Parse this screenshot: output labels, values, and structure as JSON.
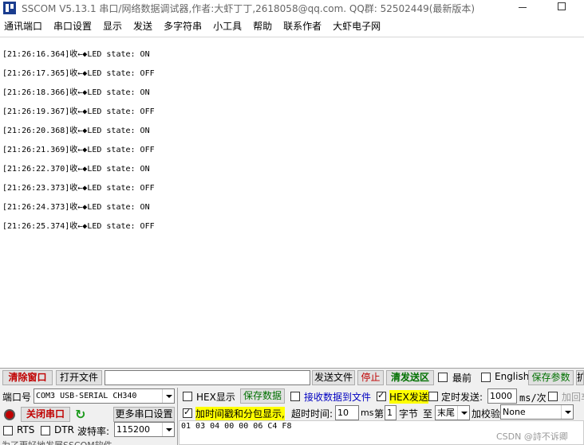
{
  "window": {
    "title": "SSCOM V5.13.1 串口/网络数据调试器,作者:大虾丁丁,2618058@qq.com. QQ群: 52502449(最新版本)"
  },
  "menu": [
    "通讯端口",
    "串口设置",
    "显示",
    "发送",
    "多字符串",
    "小工具",
    "帮助",
    "联系作者",
    "大虾电子网"
  ],
  "receive": {
    "lines": [
      "[21:26:16.364]收←◆LED state: ON",
      "[21:26:17.365]收←◆LED state: OFF",
      "[21:26:18.366]收←◆LED state: ON",
      "[21:26:19.367]收←◆LED state: OFF",
      "[21:26:20.368]收←◆LED state: ON",
      "[21:26:21.369]收←◆LED state: OFF",
      "[21:26:22.370]收←◆LED state: ON",
      "[21:26:23.373]收←◆LED state: OFF",
      "[21:26:24.373]收←◆LED state: ON",
      "[21:26:25.374]收←◆LED state: OFF"
    ]
  },
  "toolbar": {
    "clear_window": "清除窗口",
    "open_file": "打开文件",
    "file_path": "",
    "send_file": "发送文件",
    "stop": "停止",
    "clear_send": "清发送区",
    "front_label": "最前",
    "english_label": "English",
    "save_params": "保存参数",
    "expand": "扩"
  },
  "port": {
    "port_label": "端口号",
    "port_value": "COM3 USB-SERIAL CH340",
    "close_port": "关闭串口",
    "more_settings": "更多串口设置",
    "rts_label": "RTS",
    "dtr_label": "DTR",
    "baud_label": "波特率:",
    "baud_value": "115200",
    "cut_text": "为了更好地发展SSCOM软件"
  },
  "options": {
    "hex_display": "HEX显示",
    "save_data": "保存数据",
    "recv_to_file": "接收数据到文件",
    "hex_send": "HEX发送",
    "timed_send": "定时发送:",
    "interval_value": "1000",
    "interval_unit": "ms/次",
    "add_crlf": "加回车",
    "add_timestamp": "加时间戳和分包显示,",
    "timeout_label": "超时时间:",
    "timeout_value": "10",
    "timeout_unit": "ms",
    "nth_label": "第",
    "nth_value": "1",
    "byte_label": "字节",
    "to_label": "至",
    "end_value": "末尾",
    "checksum_label": "加校验",
    "checksum_value": "None"
  },
  "send": {
    "content": "01 03 04 00 00 06 C4 F8"
  },
  "watermark": "CSDN @詩不诉卿"
}
